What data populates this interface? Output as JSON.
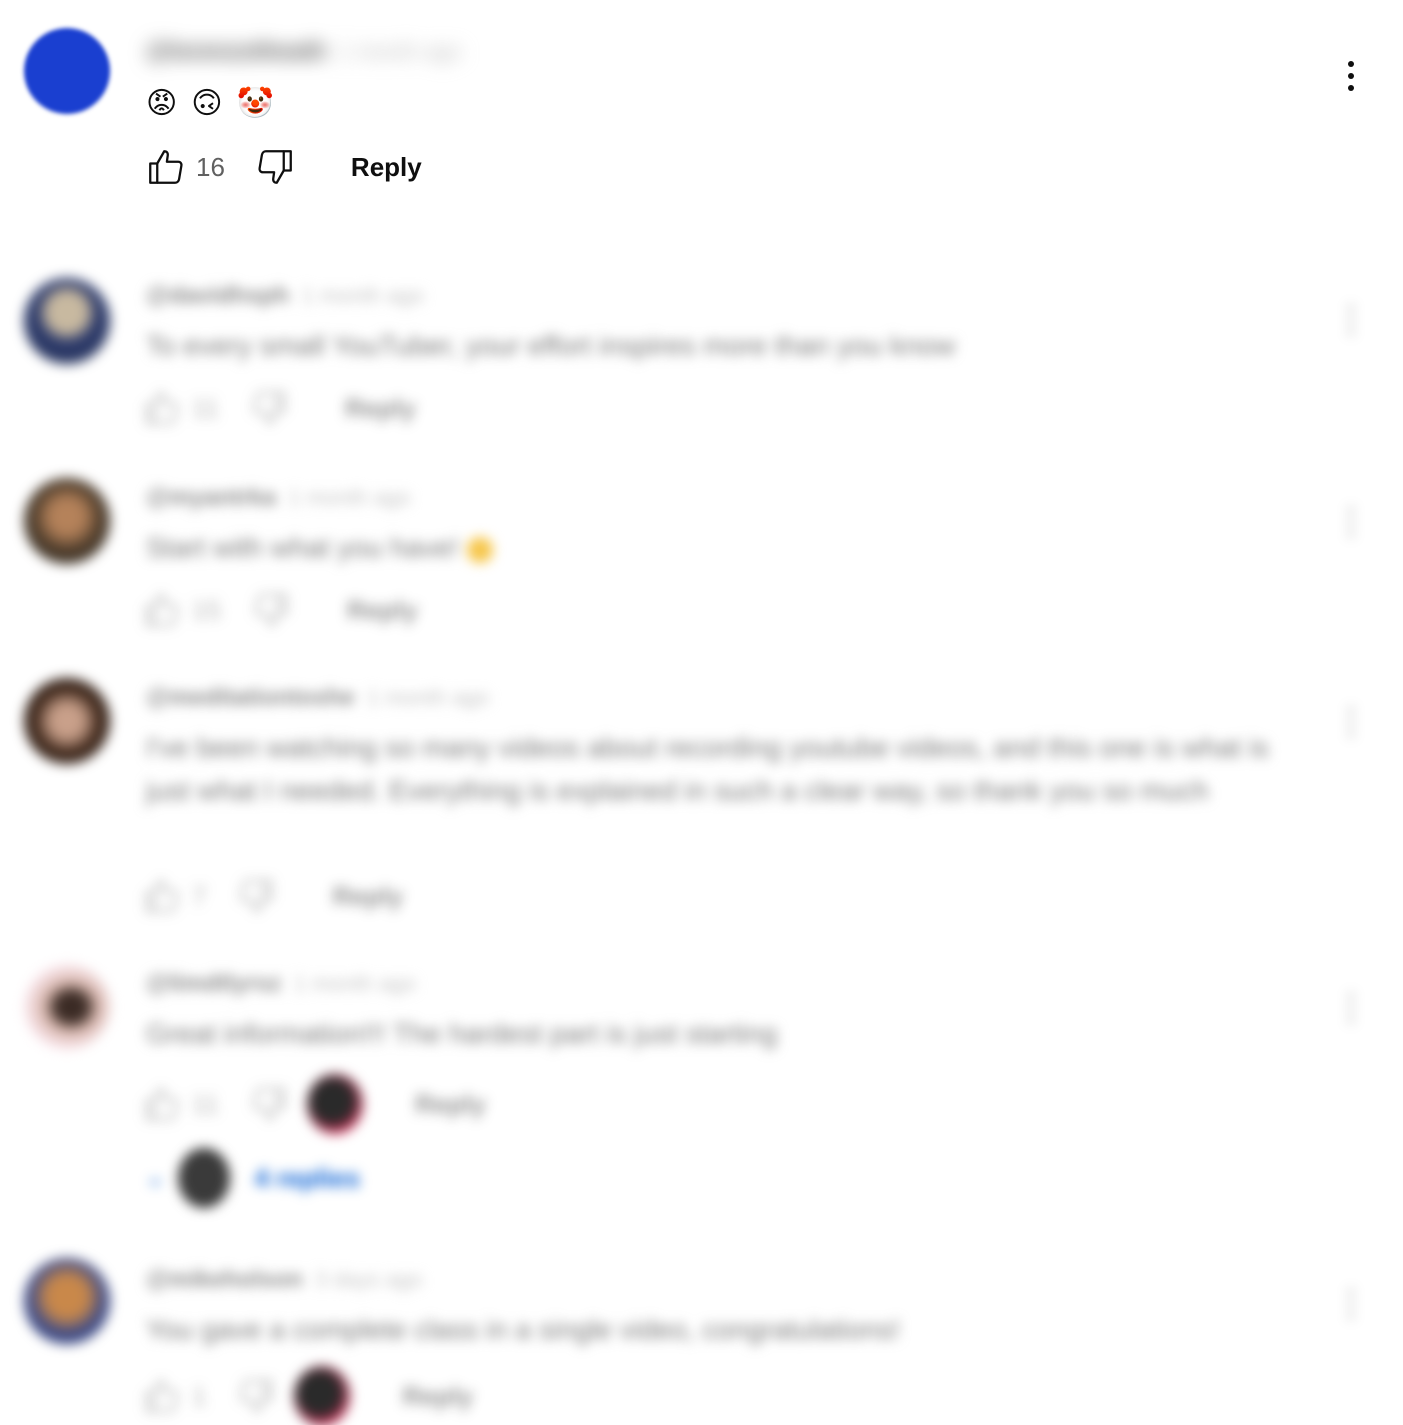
{
  "first_comment": {
    "author": "@lorenzotheath",
    "time": "1 month ago",
    "emojis": [
      "😡",
      "🙃",
      "🤡"
    ],
    "likes": "16",
    "reply_label": "Reply",
    "avatar_color": "#1a3fd0"
  },
  "comments": [
    {
      "author": "@davidhsph",
      "time": "1 month ago",
      "text": "To every small YouTuber, your effort inspires more than you know",
      "likes": "11",
      "reply_label": "Reply"
    },
    {
      "author": "@myantrka",
      "time": "1 month ago",
      "text": "Start with what you have!",
      "likes": "15",
      "reply_label": "Reply"
    },
    {
      "author": "@meditationtoshe",
      "time": "1 month ago",
      "text": "I've been watching so many videos about recording youtube videos, and this one is what is just what I needed. Everything is explained in such a clear way, so thank you so much",
      "likes": "7",
      "reply_label": "Reply"
    },
    {
      "author": "@limdtlyrsz",
      "time": "1 month ago",
      "text": "Great information!!! The hardest part is just starting",
      "likes": "11",
      "reply_label": "Reply",
      "replies_label": "4 replies"
    },
    {
      "author": "@mikeholson",
      "time": "3 days ago",
      "text": "You gave a complete class in a single video, congratulations!",
      "likes": "1",
      "reply_label": "Reply"
    }
  ],
  "colors": {
    "accent_blue": "#065fd4",
    "text_primary": "#0f0f0f",
    "text_secondary": "#606060"
  },
  "icons": [
    "thumb-up-icon",
    "thumb-down-icon",
    "more-vert-icon",
    "chevron-down-icon"
  ]
}
